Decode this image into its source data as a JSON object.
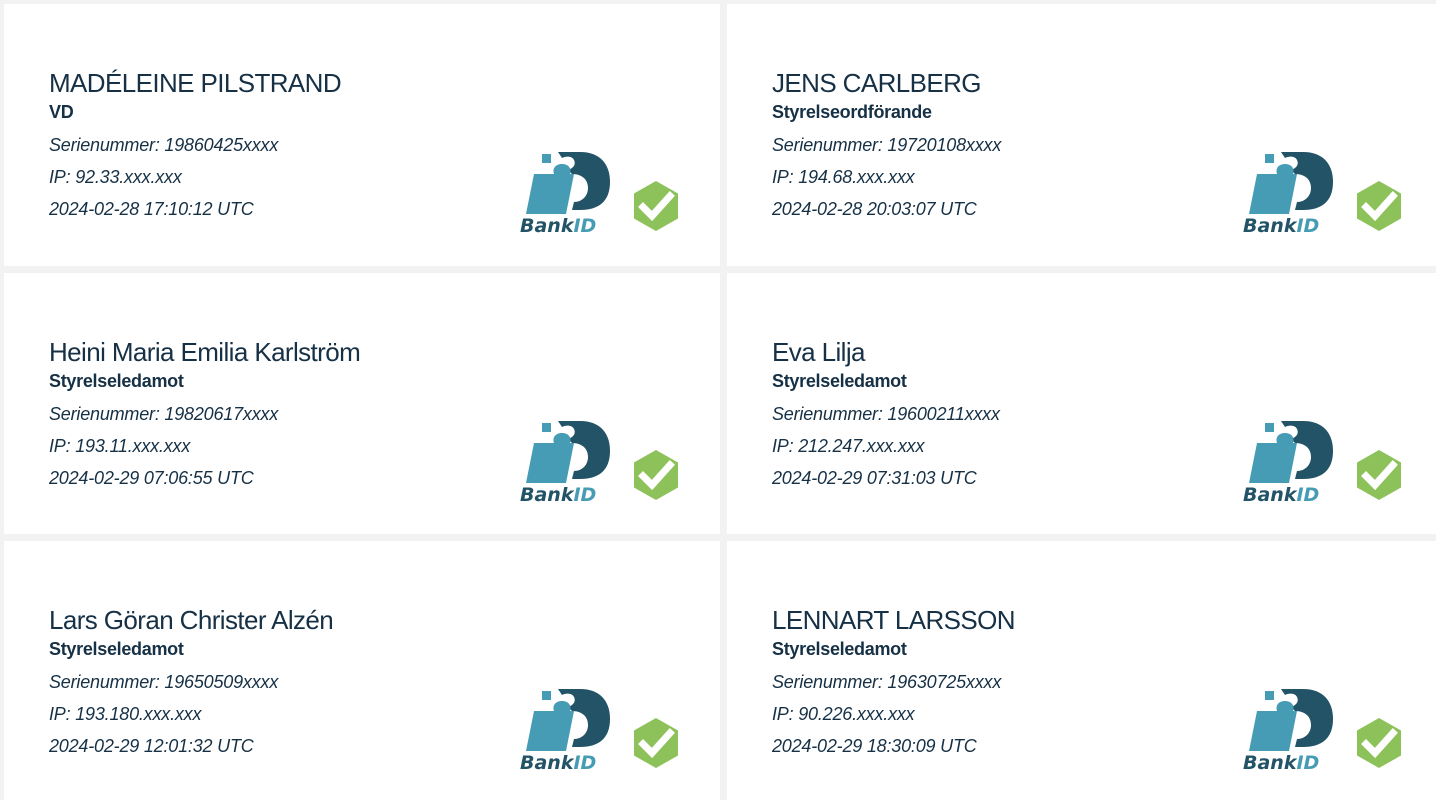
{
  "signers": [
    {
      "name": "MADÉLEINE PILSTRAND",
      "role": "VD",
      "serial": "Serienummer: 19860425xxxx",
      "ip": "IP: 92.33.xxx.xxx",
      "timestamp": "2024-02-28 17:10:12 UTC"
    },
    {
      "name": "JENS CARLBERG",
      "role": "Styrelseordförande",
      "serial": "Serienummer: 19720108xxxx",
      "ip": "IP: 194.68.xxx.xxx",
      "timestamp": "2024-02-28 20:03:07 UTC"
    },
    {
      "name": "Heini Maria Emilia Karlström",
      "role": "Styrelseledamot",
      "serial": "Serienummer: 19820617xxxx",
      "ip": "IP: 193.11.xxx.xxx",
      "timestamp": "2024-02-29 07:06:55 UTC"
    },
    {
      "name": "Eva Lilja",
      "role": "Styrelseledamot",
      "serial": "Serienummer: 19600211xxxx",
      "ip": "IP: 212.247.xxx.xxx",
      "timestamp": "2024-02-29 07:31:03 UTC"
    },
    {
      "name": "Lars Göran Christer Alzén",
      "role": "Styrelseledamot",
      "serial": "Serienummer: 19650509xxxx",
      "ip": "IP: 193.180.xxx.xxx",
      "timestamp": "2024-02-29 12:01:32 UTC"
    },
    {
      "name": "LENNART LARSSON",
      "role": "Styrelseledamot",
      "serial": "Serienummer: 19630725xxxx",
      "ip": "IP: 90.226.xxx.xxx",
      "timestamp": "2024-02-29 18:30:09 UTC"
    }
  ],
  "badge": {
    "logo_text": "BankID",
    "logo_icon": "bankid-logo",
    "check_icon": "verified-check-icon",
    "colors": {
      "dark_teal": "#235366",
      "light_teal": "#469cb4",
      "check_green": "#8dc15a",
      "text_navy": "#163045"
    }
  }
}
